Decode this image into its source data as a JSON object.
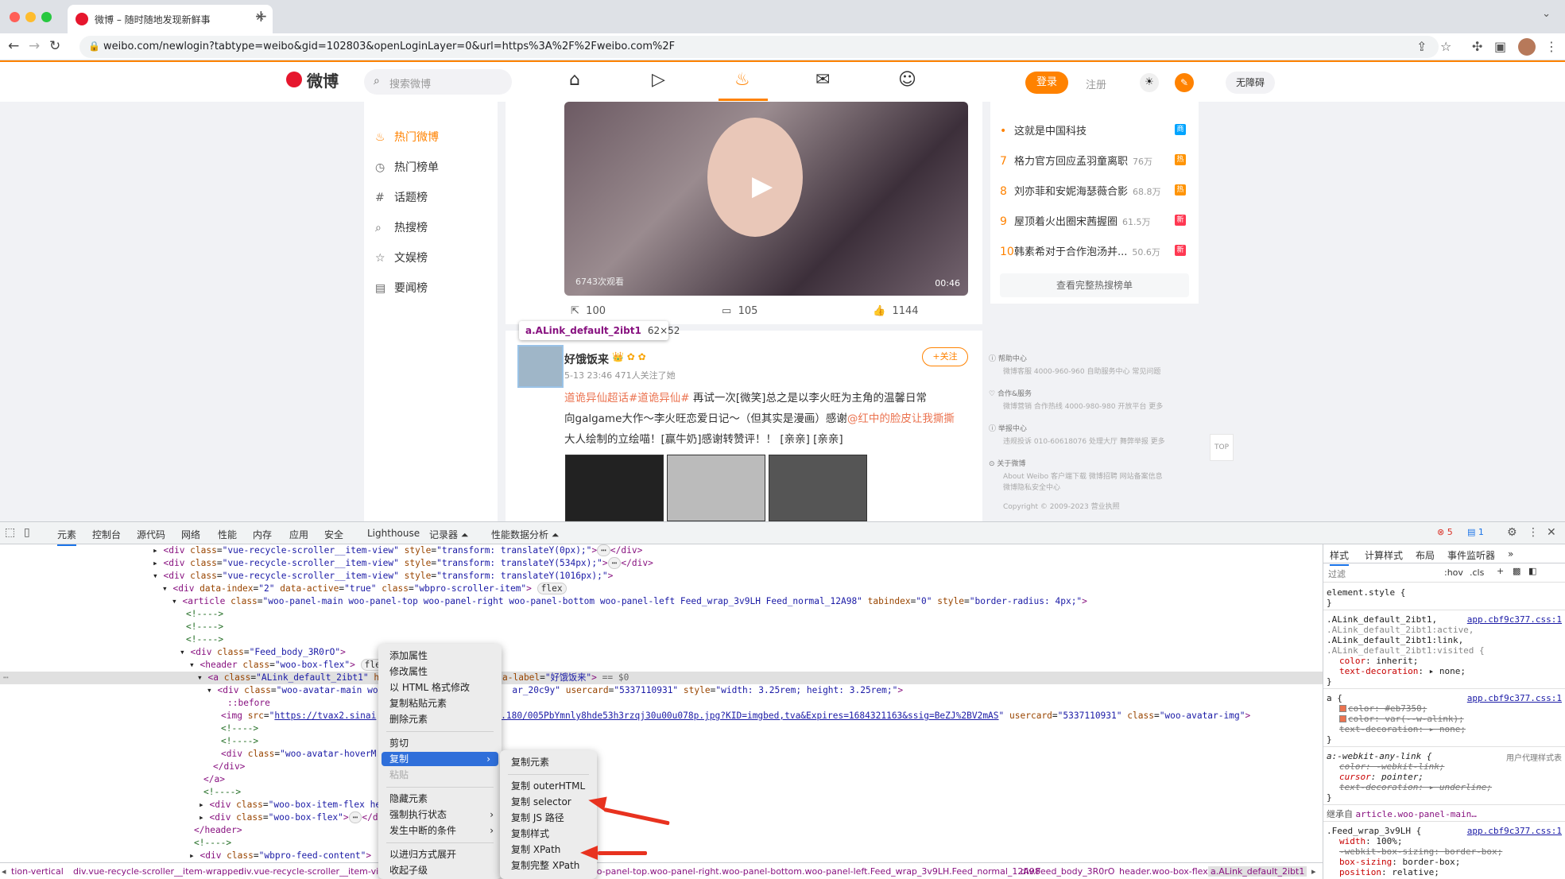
{
  "browser": {
    "tab_title": "微博 – 随时随地发现新鲜事",
    "url": "weibo.com/newlogin?tabtype=weibo&gid=102803&openLoginLayer=0&url=https%3A%2F%2Fweibo.com%2F"
  },
  "weibo_header": {
    "search_placeholder": "搜索微博",
    "logo_text": "微博",
    "login": "登录",
    "register": "注册",
    "accessibility": "无障碍"
  },
  "left_nav": [
    {
      "label": "热门微博",
      "icon": "fire-icon",
      "active": true
    },
    {
      "label": "热门榜单",
      "icon": "clock-icon",
      "active": false
    },
    {
      "label": "话题榜",
      "icon": "hash-icon",
      "active": false
    },
    {
      "label": "热搜榜",
      "icon": "search-icon",
      "active": false
    },
    {
      "label": "文娱榜",
      "icon": "star-icon",
      "active": false
    },
    {
      "label": "要闻榜",
      "icon": "news-icon",
      "active": false
    }
  ],
  "feed1": {
    "views": "6743次观看",
    "duration": "00:46",
    "shares": "100",
    "comments": "105",
    "likes": "1144"
  },
  "tooltip": {
    "name": "a.ALink_default_2ibt1",
    "size": "62×52"
  },
  "feed2": {
    "username": "好饿饭来",
    "meta": "5-13 23:46  471人关注了她",
    "follow": "+关注",
    "text_line1_tag": "道诡异仙超话#道诡异仙#",
    "text_line1": " 再试一次[微笑]总之是以李火旺为主角的温馨日常",
    "text_line2": "向galgame大作～李火旺恋爱日记～（但其实是漫画）感谢",
    "text_line2_tag": "@红中的脸皮让我撕撕",
    "text_line3": "大人绘制的立绘喵！[赢牛奶]感谢转赞评！！ [亲亲] [亲亲]"
  },
  "hot_list": {
    "items": [
      {
        "rank": "•",
        "title": "这就是中国科技",
        "count": "",
        "badge": "商",
        "badge_color": "#00a4ff"
      },
      {
        "rank": "7",
        "title": "格力官方回应孟羽童离职",
        "count": "76万",
        "badge": "热",
        "badge_color": "#ff9406"
      },
      {
        "rank": "8",
        "title": "刘亦菲和安妮海瑟薇合影",
        "count": "68.8万",
        "badge": "热",
        "badge_color": "#ff9406"
      },
      {
        "rank": "9",
        "title": "屋顶着火出圈宋茜握圈",
        "count": "61.5万",
        "badge": "新",
        "badge_color": "#ff3852"
      },
      {
        "rank": "10",
        "title": "韩素希对于合作泡汤并...",
        "count": "50.6万",
        "badge": "新",
        "badge_color": "#ff3852"
      }
    ],
    "more": "查看完整热搜榜单"
  },
  "footer": {
    "help_title": "帮助中心",
    "help_links": "微博客服 4000-960-960    自助服务中心    常见问题",
    "coop_title": "合作&服务",
    "coop_links": "微博营销    合作热线 4000-980-980    开放平台    更多",
    "report_title": "举报中心",
    "report_links": "违规投诉 010-60618076    处理大厅    舞弊举报    更多",
    "about_title": "关于微博",
    "about_links": "About Weibo    客户端下载    微博招聘    网站备案信息",
    "privacy": "微博隐私安全中心",
    "copyright": "Copyright © 2009-2023 营业执照",
    "top": "TOP"
  },
  "devtools": {
    "tabs": [
      "元素",
      "控制台",
      "源代码",
      "网络",
      "性能",
      "内存",
      "应用",
      "安全",
      "Lighthouse",
      "记录器 ⏶",
      "性能数据分析 ⏶"
    ],
    "errors": "5",
    "messages": "1",
    "style_tabs": [
      "样式",
      "计算样式",
      "布局",
      "事件监听器",
      "»"
    ],
    "filter": "过滤",
    "hov": ":hov",
    "cls": ".cls",
    "breadcrumbs": [
      "tion-vertical",
      "div.vue-recycle-scroller__item-wrapper",
      "div.vue-recycle-scroller__item-view",
      "oo-panel-top.woo-panel-right.woo-panel-bottom.woo-panel-left.Feed_wrap_3v9LH.Feed_normal_12A98",
      "div.Feed_body_3R0rO",
      "header.woo-box-flex",
      "a.ALink_default_2ibt1"
    ]
  },
  "context_menu": {
    "items": [
      "添加属性",
      "修改属性",
      "以 HTML 格式修改",
      "复制粘贴元素",
      "删除元素",
      "剪切",
      "复制",
      "粘贴",
      "隐藏元素",
      "强制执行状态",
      "发生中断的条件",
      "以进归方式展开",
      "收起子级"
    ],
    "submenu": [
      "复制元素",
      "复制 outerHTML",
      "复制 selector",
      "复制 JS 路径",
      "复制样式",
      "复制 XPath",
      "复制完整 XPath"
    ]
  }
}
